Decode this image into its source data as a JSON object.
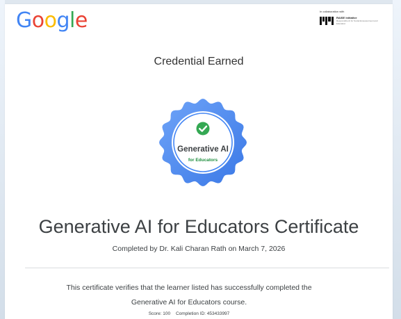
{
  "header": {
    "logo_letters": [
      "G",
      "o",
      "o",
      "g",
      "l",
      "e"
    ],
    "logo_colors": [
      "#4285F4",
      "#EA4335",
      "#FBBC05",
      "#4285F4",
      "#34A853",
      "#EA4335"
    ],
    "collab_label": "In collaboration with",
    "partner_title": "RAISE Initiative",
    "partner_desc": "Responsible AI for Social Empowerment and Education"
  },
  "heading": "Credential Earned",
  "badge": {
    "icon": "check-circle-icon",
    "title": "Generative AI",
    "subtitle": "for Educators",
    "ring_color": "#4285F4",
    "check_color": "#34A853"
  },
  "certificate": {
    "title": "Generative AI for Educators Certificate",
    "completed_by": "Completed by Dr. Kali Charan Rath on March 7, 2026",
    "verify_line_1": "This certificate verifies that the learner listed has successfully completed the",
    "verify_line_2": "Generative AI for Educators course.",
    "score": "Score: 100",
    "completion_id": "Completion ID: 453433997"
  }
}
